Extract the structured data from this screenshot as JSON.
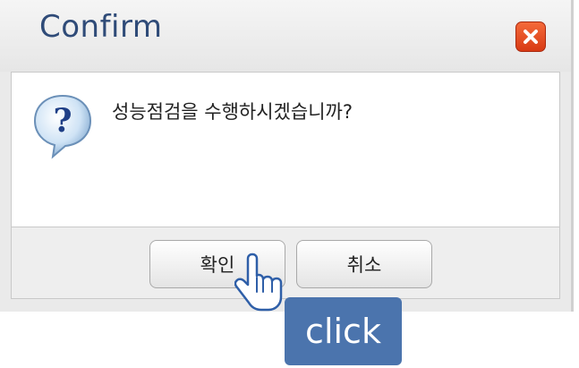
{
  "dialog": {
    "title": "Confirm",
    "message": "성능점검을 수행하시겠습니까?",
    "icon": "question-icon",
    "close_icon": "close-icon",
    "colors": {
      "title": "#2f4b78",
      "close": "#e04a20",
      "accent": "#4b74ad"
    }
  },
  "buttons": {
    "ok_label": "확인",
    "cancel_label": "취소"
  },
  "annotation": {
    "label": "click",
    "cursor_icon": "hand-pointer-icon"
  }
}
